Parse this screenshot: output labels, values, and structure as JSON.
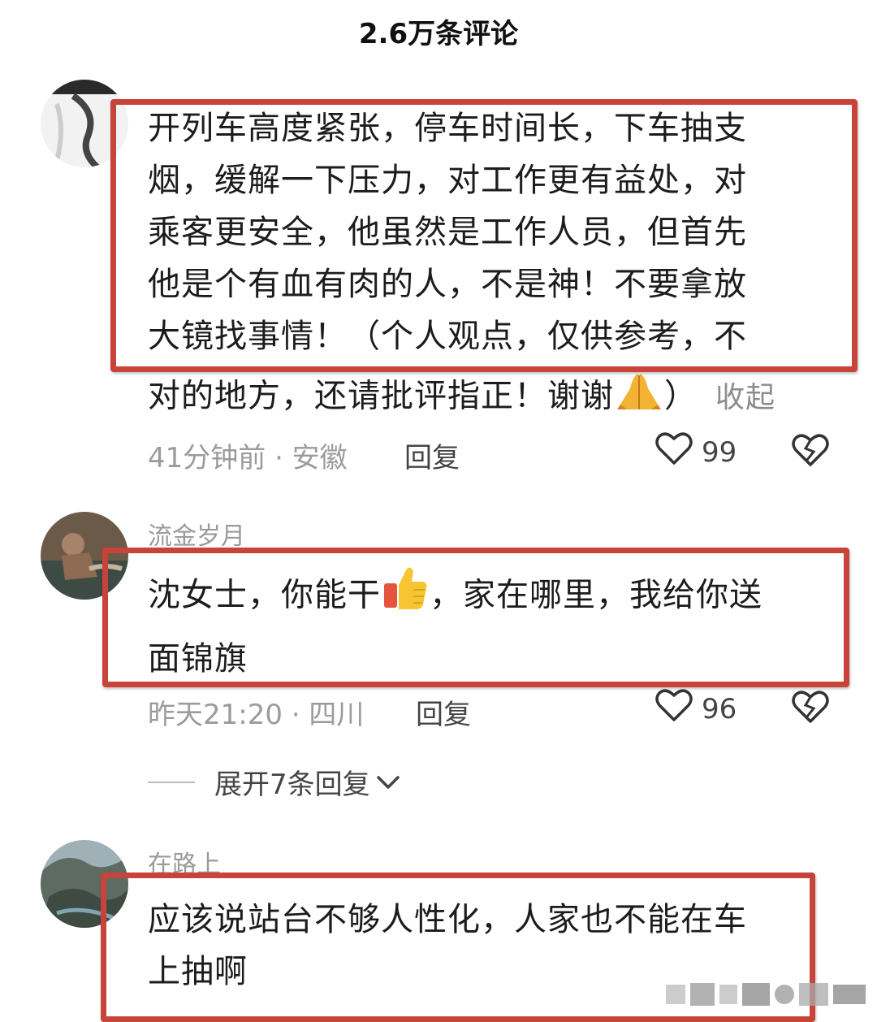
{
  "header": {
    "title": "2.6万条评论"
  },
  "comments": [
    {
      "username": "",
      "lines": [
        "开列车高度紧张，停车时间长，下车抽支",
        "烟，缓解一下压力，对工作更有益处，对",
        "乘客更安全，他虽然是工作人员，但首先",
        "他是个有血有肉的人，不是神！不要拿放",
        "大镜找事情！（个人观点，仅供参考，不",
        "对的地方，还请批评指正！谢谢",
        "）"
      ],
      "emoji": "folded-hands-emoji",
      "collapse_label": "收起",
      "meta": "41分钟前 · 安徽",
      "reply_label": "回复",
      "likes": "99"
    },
    {
      "username": "流金岁月",
      "lines": [
        "沈女士，你能干",
        "，家在哪里，我给你送",
        "面锦旗"
      ],
      "emoji": "thumbs-up-emoji",
      "meta": "昨天21:20 · 四川",
      "reply_label": "回复",
      "likes": "96",
      "expand_label": "展开7条回复"
    },
    {
      "username": "在路上",
      "lines": [
        "应该说站台不够人性化，人家也不能在车",
        "上抽啊"
      ]
    }
  ],
  "colors": {
    "highlight_box": "#c8443b",
    "meta_text": "#9b9b9b"
  },
  "icons": [
    "heart-outline-icon",
    "broken-heart-icon",
    "chevron-down-icon"
  ]
}
